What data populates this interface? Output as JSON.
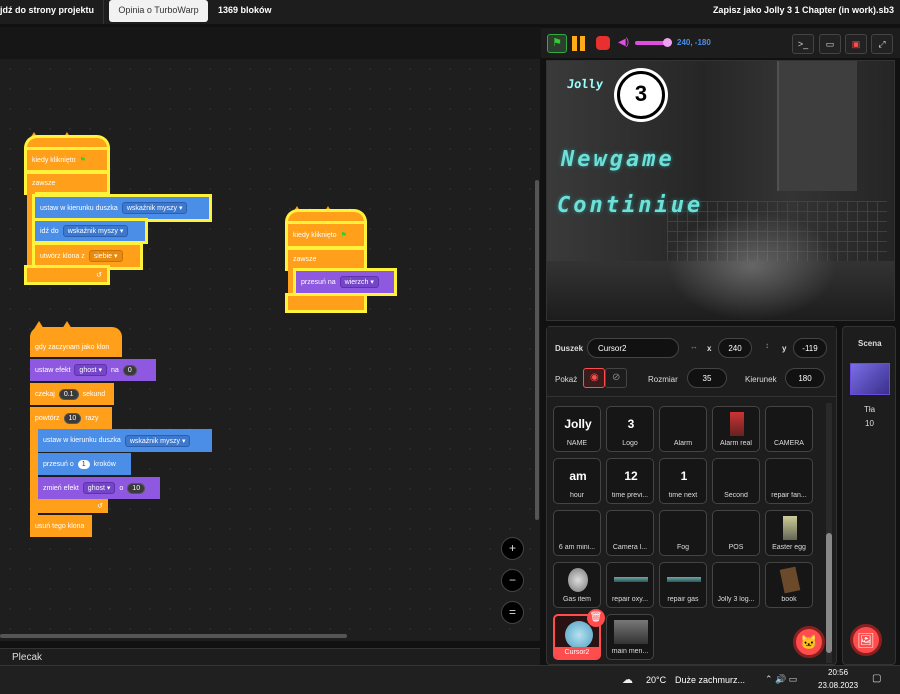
{
  "topbar": {
    "back_label": "jdź do strony projektu",
    "feedback_label": "Opinia o TurboWarp",
    "block_count": "1369 bloków",
    "save_label": "Zapisz jako Jolly 3 1 Chapter (in work).sb3"
  },
  "scripts": {
    "s1": {
      "hat": "kiedy kliknięto",
      "forever": "zawsze",
      "point": "ustaw w kierunku duszka",
      "point_val": "wskaźnik myszy",
      "goto": "idź do",
      "goto_val": "wskaźnik myszy",
      "clone": "utwórz klona z",
      "clone_val": "siebie"
    },
    "s2": {
      "hat": "kiedy kliknięto",
      "forever": "zawsze",
      "move": "przesuń na",
      "move_val": "wierzch"
    },
    "s3": {
      "hat": "gdy zaczynam jako klon",
      "seteff": "ustaw efekt",
      "seteff_val": "ghost",
      "seteff_to": "na",
      "seteff_num": "0",
      "wait": "czekaj",
      "wait_num": "0.1",
      "wait_unit": "sekund",
      "repeat": "powtórz",
      "repeat_num": "10",
      "repeat_unit": "razy",
      "point": "ustaw w kierunku duszka",
      "point_val": "wskaźnik myszy",
      "move": "przesuń o",
      "move_num": "1",
      "move_unit": "kroków",
      "change": "zmień efekt",
      "change_val": "ghost",
      "change_by": "o",
      "change_num": "10",
      "delete": "usuń tego klona"
    }
  },
  "backpack_label": "Plecak",
  "stage_controls": {
    "coords": "240, -180",
    "volume_level": 0.85
  },
  "stage": {
    "logo_text": "Jolly",
    "badge": "3",
    "menu_new": "Newgame",
    "menu_continue": "Continiue"
  },
  "sprite_info": {
    "sprite_label": "Duszek",
    "sprite_name": "Cursor2",
    "x_label": "x",
    "x": "240",
    "y_label": "y",
    "y": "-119",
    "show_label": "Pokaż",
    "size_label": "Rozmiar",
    "size": "35",
    "direction_label": "Kierunek",
    "direction": "180"
  },
  "sprites": [
    {
      "name": "NAME",
      "thumb": "Jolly"
    },
    {
      "name": "Logo",
      "thumb": "3"
    },
    {
      "name": "Alarm",
      "thumb": ""
    },
    {
      "name": "Alarm real",
      "thumb": ""
    },
    {
      "name": "CAMERA",
      "thumb": ""
    },
    {
      "name": "hour",
      "thumb": "am"
    },
    {
      "name": "time previ...",
      "thumb": "12"
    },
    {
      "name": "time next",
      "thumb": "1"
    },
    {
      "name": "Second",
      "thumb": ""
    },
    {
      "name": "repair fan...",
      "thumb": ""
    },
    {
      "name": "6 am mini...",
      "thumb": ""
    },
    {
      "name": "Camera l...",
      "thumb": ""
    },
    {
      "name": "Fog",
      "thumb": ""
    },
    {
      "name": "POS",
      "thumb": ""
    },
    {
      "name": "Easter egg",
      "thumb": ""
    },
    {
      "name": "Gas item",
      "thumb": ""
    },
    {
      "name": "repair oxy...",
      "thumb": ""
    },
    {
      "name": "repair gas",
      "thumb": ""
    },
    {
      "name": "Jolly 3 log...",
      "thumb": ""
    },
    {
      "name": "book",
      "thumb": ""
    },
    {
      "name": "Cursor2",
      "thumb": ""
    },
    {
      "name": "main men...",
      "thumb": ""
    }
  ],
  "scene": {
    "title": "Scena",
    "backdrops_label": "Tła",
    "backdrops_count": "10"
  },
  "taskbar": {
    "temp": "20°C",
    "weather": "Duże zachmurz...",
    "time": "20:56",
    "date": "23.08.2023"
  }
}
